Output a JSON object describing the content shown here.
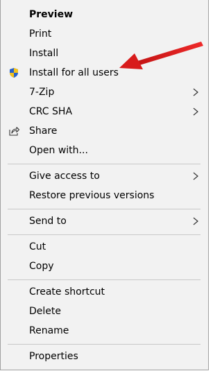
{
  "menu": {
    "items": [
      {
        "id": "preview",
        "label": "Preview",
        "bold": true
      },
      {
        "id": "print",
        "label": "Print"
      },
      {
        "id": "install",
        "label": "Install"
      },
      {
        "id": "install-all-users",
        "label": "Install for all users",
        "icon": "uac-shield-icon"
      },
      {
        "id": "7zip",
        "label": "7-Zip",
        "submenu": true
      },
      {
        "id": "crc-sha",
        "label": "CRC SHA",
        "submenu": true
      },
      {
        "id": "share",
        "label": "Share",
        "icon": "share-icon"
      },
      {
        "id": "open-with",
        "label": "Open with..."
      },
      {
        "id": "give-access",
        "label": "Give access to",
        "submenu": true
      },
      {
        "id": "restore-versions",
        "label": "Restore previous versions"
      },
      {
        "id": "send-to",
        "label": "Send to",
        "submenu": true
      },
      {
        "id": "cut",
        "label": "Cut"
      },
      {
        "id": "copy",
        "label": "Copy"
      },
      {
        "id": "create-shortcut",
        "label": "Create shortcut"
      },
      {
        "id": "delete",
        "label": "Delete"
      },
      {
        "id": "rename",
        "label": "Rename"
      },
      {
        "id": "properties",
        "label": "Properties"
      }
    ]
  },
  "annotation": {
    "icon": "red-arrow-icon",
    "color": "#e11b1b"
  },
  "colors": {
    "menu_bg": "#f2f2f2",
    "separator": "#c8c8c8",
    "text": "#000000"
  }
}
